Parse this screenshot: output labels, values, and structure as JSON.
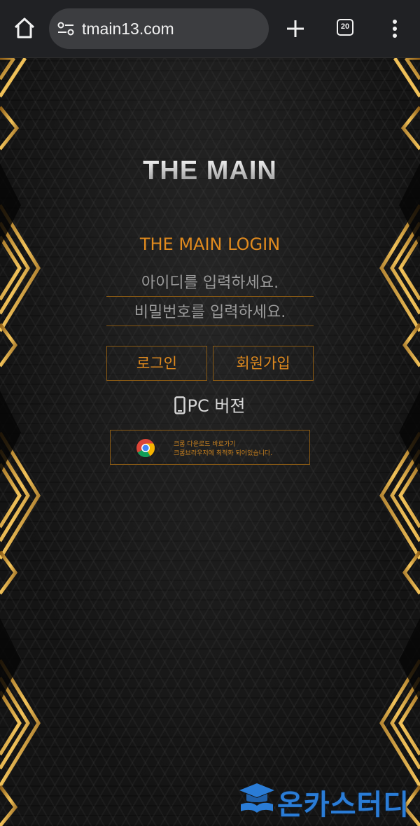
{
  "browser": {
    "url": "tmain13.com",
    "tab_count": "20",
    "icons": [
      "home-icon",
      "site-settings-icon",
      "new-tab-icon",
      "tabs-icon",
      "more-menu-icon"
    ]
  },
  "page": {
    "logo_text": "THE MAIN",
    "login_title": "THE MAIN LOGIN",
    "id_placeholder": "아이디를 입력하세요.",
    "pw_placeholder": "비밀번호를 입력하세요.",
    "login_button": "로그인",
    "signup_button": "회원가입",
    "pc_version": "PC 버젼",
    "chrome_line1": "크롬 다운로드 바로가기",
    "chrome_line2": "크롬브라우저에 최적화 되어있습니다.",
    "watermark": "온카스터디"
  },
  "colors": {
    "accent": "#e08a1e",
    "border": "#8a5a14",
    "gold": "#d9a441",
    "watermark_blue": "#2a7cd6"
  }
}
